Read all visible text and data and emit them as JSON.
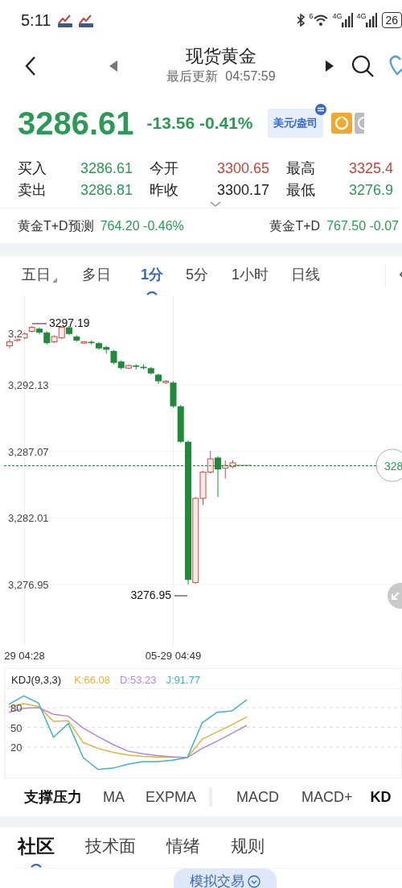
{
  "status_bar": {
    "time": "5:11",
    "wifi_band": "6",
    "signals": [
      "4G",
      "4G"
    ],
    "battery": "26"
  },
  "header": {
    "title": "现货黄金",
    "subtitle": "最后更新  04:57:59"
  },
  "price": {
    "last": "3286.61",
    "change": "-13.56 -0.41%",
    "unit": "美元/盎司"
  },
  "quotes": [
    {
      "label": "买入",
      "value": "3286.61",
      "color": "#2b9a55"
    },
    {
      "label": "今开",
      "value": "3300.65",
      "color": "#c5443e"
    },
    {
      "label": "最高",
      "value": "3325.4",
      "color": "#c5443e"
    },
    {
      "label": "卖出",
      "value": "3286.81",
      "color": "#2b9a55"
    },
    {
      "label": "昨收",
      "value": "3300.17",
      "color": "#222222"
    },
    {
      "label": "最低",
      "value": "3276.9",
      "color": "#2b9a55"
    }
  ],
  "related": [
    {
      "name": "黄金T+D预测",
      "quote": "764.20 -0.46%"
    },
    {
      "name": "黄金T+D",
      "quote": "767.50 -0.07"
    }
  ],
  "periods": [
    {
      "label": "五日",
      "selected": false,
      "menu": true
    },
    {
      "label": "多日",
      "selected": false,
      "menu": false
    },
    {
      "label": "1分",
      "selected": true,
      "menu": false
    },
    {
      "label": "5分",
      "selected": false,
      "menu": false
    },
    {
      "label": "1小时",
      "selected": false,
      "menu": false
    },
    {
      "label": "日线",
      "selected": false,
      "menu": false
    }
  ],
  "chart": {
    "top_label": "3,2",
    "high_label": "3297.19",
    "low_label": "3276.95",
    "current_tag": "328",
    "chart_data": {
      "type": "candlestick",
      "grid": true,
      "categories": [
        null,
        null,
        "29 04:28",
        null,
        null,
        null,
        null,
        null,
        null,
        null,
        null,
        null,
        null,
        null,
        null,
        null,
        null,
        null,
        null,
        null,
        null,
        null,
        "05-29 04:49",
        null,
        null,
        null,
        null,
        null,
        null,
        null,
        null
      ],
      "ylim": [
        3272.3,
        3298.92
      ],
      "yticks": [
        {
          "value": 3292.13,
          "label": "3,292.13"
        },
        {
          "value": 3287.07,
          "label": "3,287.07"
        },
        {
          "value": 3282.01,
          "label": "3,282.01"
        },
        {
          "value": 3276.95,
          "label": "3,276.95"
        }
      ],
      "ohlc": [
        [
          3295.1,
          3295.6,
          3294.9,
          3295.4
        ],
        [
          3295.5,
          3295.7,
          3295.4,
          3295.6
        ],
        [
          3295.7,
          3296.1,
          3295.6,
          3296.0
        ],
        [
          3296.2,
          3296.6,
          3296.1,
          3296.5
        ],
        [
          3296.4,
          3296.5,
          3296.0,
          3296.1
        ],
        [
          3296.1,
          3296.2,
          3295.2,
          3295.3
        ],
        [
          3295.4,
          3295.9,
          3295.3,
          3295.8
        ],
        [
          3295.7,
          3296.6,
          3295.6,
          3296.5
        ],
        [
          3296.5,
          3296.6,
          3295.9,
          3296.0
        ],
        [
          3295.8,
          3295.9,
          3295.4,
          3295.5
        ],
        [
          3295.3,
          3295.4,
          3295.3,
          3295.4
        ],
        [
          3295.4,
          3295.5,
          3295.2,
          3295.3
        ],
        [
          3295.3,
          3295.4,
          3294.8,
          3294.9
        ],
        [
          3295.0,
          3295.1,
          3294.5,
          3294.8
        ],
        [
          3294.7,
          3294.8,
          3293.7,
          3293.8
        ],
        [
          3293.9,
          3294.0,
          3293.3,
          3293.4
        ],
        [
          3293.4,
          3293.7,
          3293.3,
          3293.6
        ],
        [
          3293.6,
          3293.7,
          3293.3,
          3293.5
        ],
        [
          3293.5,
          3293.7,
          3293.3,
          3293.4
        ],
        [
          3293.4,
          3293.5,
          3292.9,
          3293.0
        ],
        [
          3292.9,
          3293.0,
          3292.2,
          3292.4
        ],
        [
          3292.3,
          3292.5,
          3292.2,
          3292.4
        ],
        [
          3292.3,
          3292.4,
          3290.4,
          3290.5
        ],
        [
          3290.5,
          3290.6,
          3287.7,
          3287.8
        ],
        [
          3287.8,
          3287.9,
          3276.95,
          3277.3
        ],
        [
          3277.1,
          3283.6,
          3277.0,
          3283.5
        ],
        [
          3283.5,
          3285.6,
          3283.0,
          3285.5
        ],
        [
          3285.5,
          3287.1,
          3285.4,
          3286.5
        ],
        [
          3286.6,
          3286.7,
          3283.6,
          3285.7
        ],
        [
          3285.8,
          3286.4,
          3285.0,
          3286.0
        ],
        [
          3285.9,
          3286.4,
          3285.8,
          3286.2
        ]
      ]
    }
  },
  "kdj": {
    "title": "KDJ(9,3,3)",
    "legend": [
      "K:66.08",
      "D:53.23",
      "J:91.77"
    ],
    "chart_data": {
      "type": "line",
      "grid": true,
      "ylim": [
        -27.8,
        109.4
      ],
      "categories": [
        null,
        null,
        null,
        null,
        null,
        null,
        null,
        null,
        null,
        null,
        null,
        null,
        null,
        null,
        null,
        null,
        null,
        null,
        null,
        null,
        null,
        null,
        null,
        null,
        null,
        null,
        null
      ],
      "yticks": [
        {
          "value": 80,
          "label": "80"
        },
        {
          "value": 50,
          "label": "50"
        },
        {
          "value": 20,
          "label": "20"
        }
      ],
      "series": [
        {
          "color": "#e0b43a",
          "values": [
            81,
            86,
            82,
            59,
            60,
            27,
            18,
            12,
            8,
            6,
            5,
            5,
            4,
            32,
            43,
            54,
            66,
            null,
            null,
            null,
            null,
            null,
            null,
            null,
            null,
            null,
            null
          ]
        },
        {
          "color": "#b887d2",
          "values": [
            73,
            79,
            80,
            70,
            67,
            49,
            36,
            24,
            14,
            10,
            7,
            5,
            4,
            18,
            29,
            41,
            53,
            null,
            null,
            null,
            null,
            null,
            null,
            null,
            null,
            null,
            null
          ]
        },
        {
          "color": "#3db7b9",
          "values": [
            85,
            98,
            87,
            35,
            56,
            4,
            -14,
            -12,
            -6,
            -2,
            -2,
            0,
            4,
            57,
            73,
            75,
            92,
            null,
            null,
            null,
            null,
            null,
            null,
            null,
            null,
            null,
            null
          ]
        }
      ]
    }
  },
  "indicator_groups": [
    [
      {
        "label": "支撑压力",
        "active": true
      },
      {
        "label": "MA",
        "active": false
      },
      {
        "label": "EXPMA",
        "active": false
      }
    ],
    [
      {
        "label": "MACD",
        "active": false
      },
      {
        "label": "MACD+",
        "active": false
      },
      {
        "label": "KD",
        "active": true
      }
    ]
  ],
  "bottom_tabs": [
    {
      "label": "社区",
      "selected": true
    },
    {
      "label": "技术面",
      "selected": false
    },
    {
      "label": "情绪",
      "selected": false
    },
    {
      "label": "规则",
      "selected": false
    }
  ],
  "sim_button": "模拟交易"
}
